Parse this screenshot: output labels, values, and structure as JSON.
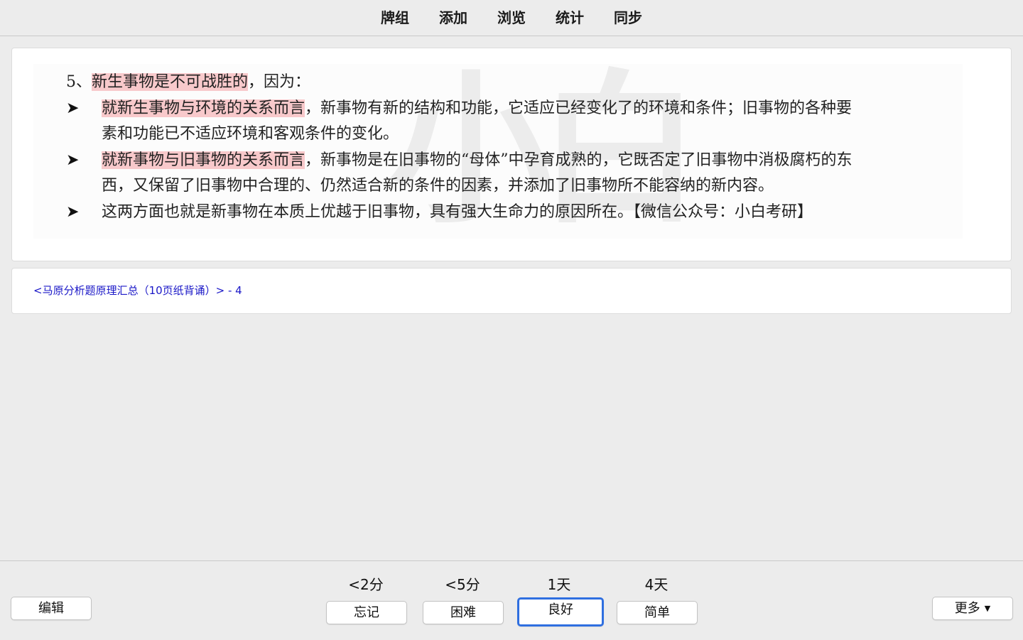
{
  "nav": {
    "items": [
      "牌组",
      "添加",
      "浏览",
      "统计",
      "同步"
    ]
  },
  "card": {
    "heading_prefix": "5、",
    "heading_highlight": "新生事物是不可战胜的",
    "heading_suffix": "，因为：",
    "bullet_glyph": "➤",
    "points": [
      {
        "highlight": "就新生事物与环境的关系而言",
        "line1": "，新事物有新的结构和功能，它适应已经变化了的环境和条件；旧事物的各种要",
        "line2": "素和功能已不适应环境和客观条件的变化。"
      },
      {
        "highlight": "就新事物与旧事物的关系而言",
        "line1": "，新事物是在旧事物的“母体”中孕育成熟的，它既否定了旧事物中消极腐朽的东",
        "line2": "西，又保留了旧事物中合理的、仍然适合新的条件的因素，并添加了旧事物所不能容纳的新内容。"
      },
      {
        "line1": "这两方面也就是新事物在本质上优越于旧事物，具有强大生命力的原因所在。【微信公众号：小白考研】"
      }
    ],
    "watermark": "小白"
  },
  "deck": {
    "link": "<马原分析题原理汇总（10页纸背诵）> - 4"
  },
  "bottom": {
    "edit_label": "编辑",
    "more_label": "更多",
    "answers": [
      {
        "interval": "<2分",
        "label": "忘记"
      },
      {
        "interval": "<5分",
        "label": "困难"
      },
      {
        "interval": "1天",
        "label": "良好"
      },
      {
        "interval": "4天",
        "label": "简单"
      }
    ]
  },
  "colors": {
    "highlight": "#f8c9cb",
    "link": "#1a17c7",
    "focus_ring": "#2f6fe0"
  }
}
